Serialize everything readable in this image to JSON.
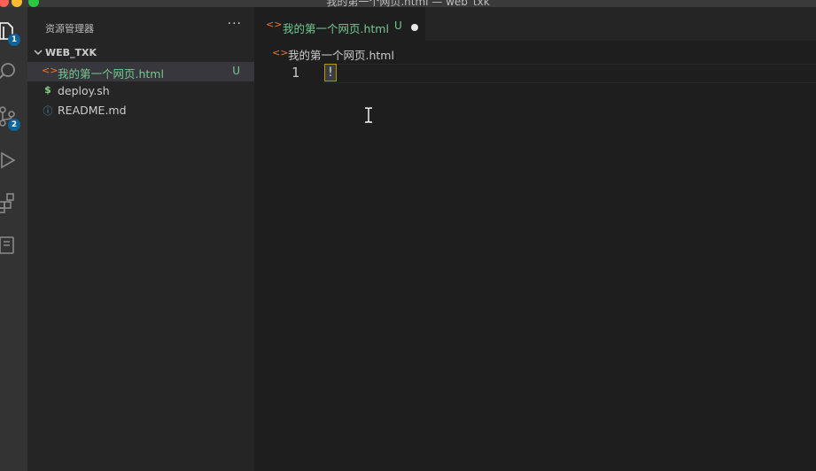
{
  "window": {
    "title": "我的第一个网页.html — web_txk"
  },
  "activity_bar": {
    "explorer_badge": "1",
    "source_control_badge": "2",
    "icons": [
      "files-icon",
      "search-icon",
      "source-control-icon",
      "run-debug-icon",
      "extensions-icon",
      "remote-explorer-icon"
    ]
  },
  "sidebar": {
    "title": "资源管理器",
    "more_label": "···",
    "folder": {
      "name": "WEB_TXK",
      "files": [
        {
          "name": "我的第一个网页.html",
          "icon": "<>",
          "status": "U",
          "icon_color": "#e37933",
          "name_color": "#73c991"
        },
        {
          "name": "deploy.sh",
          "icon": "$",
          "status": "",
          "icon_color": "#89d185",
          "name_color": "#cccccc"
        },
        {
          "name": "README.md",
          "icon": "ⓘ",
          "status": "",
          "icon_color": "#519aba",
          "name_color": "#cccccc"
        }
      ]
    }
  },
  "tabs": [
    {
      "label": "我的第一个网页.html",
      "status": "U",
      "icon": "<>",
      "dirty": true
    }
  ],
  "breadcrumb": {
    "file": "我的第一个网页.html",
    "icon": "<>"
  },
  "editor": {
    "lines": [
      {
        "number": "1",
        "text": "!"
      }
    ]
  }
}
